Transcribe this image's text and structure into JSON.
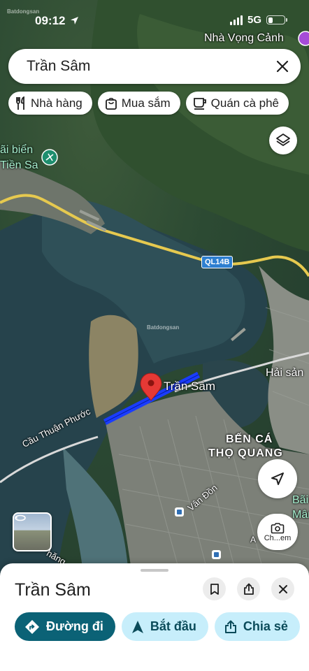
{
  "status_bar": {
    "time": "09:12",
    "network": "5G",
    "battery_level": 0.3
  },
  "search": {
    "query": "Trần Sâm"
  },
  "chips": [
    {
      "label": "Nhà hàng",
      "icon": "fork-knife-icon"
    },
    {
      "label": "Mua sắm",
      "icon": "shopping-bag-icon"
    },
    {
      "label": "Quán cà phê",
      "icon": "coffee-cup-icon"
    }
  ],
  "map": {
    "labels": {
      "top_right_place": "Nhà Vọng Cảnh",
      "beach_line1": "ãi biển",
      "beach_line2": "Tiền Sa",
      "road_badge": "QL14B",
      "pin_label": "Trần Sâm",
      "restaurant": "Hải sản",
      "port_line1": "BẾN CÁ",
      "port_line2": "THỌ QUANG",
      "bridge": "Cầu Thuận Phước",
      "street": "Vân Đồn",
      "edge_line1": "Bãi",
      "edge_line2": "Mân",
      "edge_bottom": "hăng",
      "marker_bottom": "A"
    },
    "watermark": "Batdongsan",
    "accent_route": "#1a3cff",
    "pin_color": "#e53935"
  },
  "controls": {
    "lens_label": "Ch...em"
  },
  "sheet": {
    "title": "Trần Sâm",
    "actions": [
      {
        "label": "Đường đi",
        "icon": "directions-icon"
      },
      {
        "label": "Bắt đầu",
        "icon": "navigation-arrow-icon"
      },
      {
        "label": "Chia sẻ",
        "icon": "share-icon"
      }
    ]
  }
}
